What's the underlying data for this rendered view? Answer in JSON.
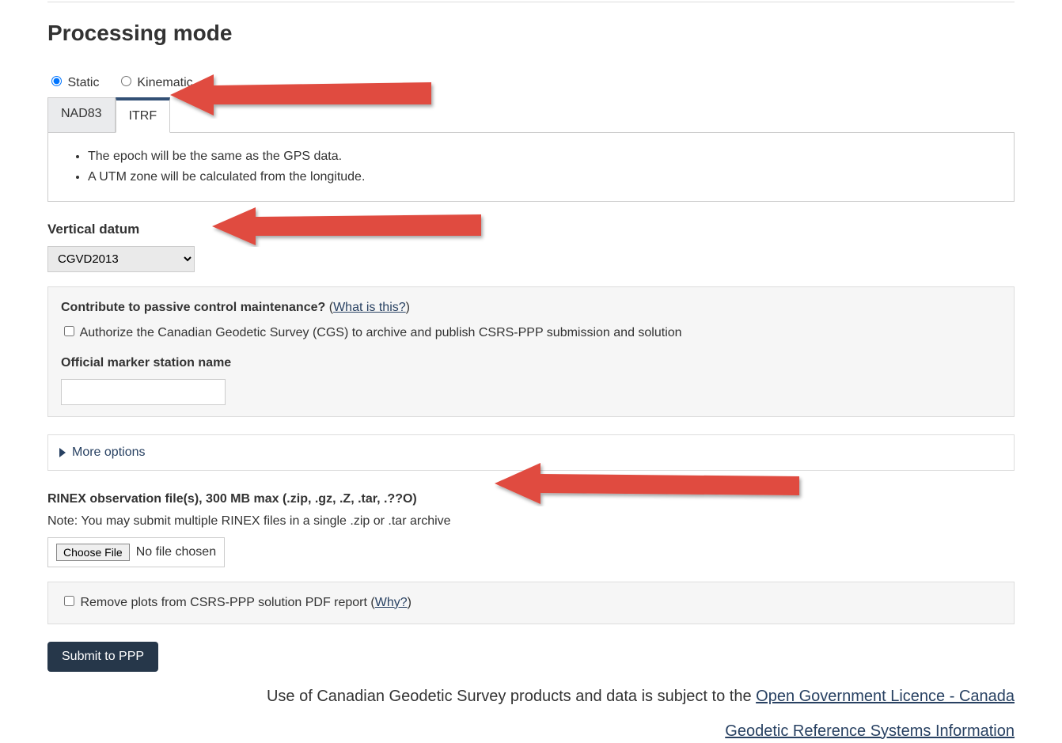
{
  "title": "Processing mode",
  "radios": {
    "static": "Static",
    "kinematic": "Kinematic",
    "selected": "static"
  },
  "tabs": {
    "nad83": "NAD83",
    "itrf": "ITRF",
    "active": "itrf",
    "bullets": [
      "The epoch will be the same as the GPS data.",
      "A UTM zone will be calculated from the longitude."
    ]
  },
  "vertical_datum": {
    "label": "Vertical datum",
    "selected": "CGVD2013"
  },
  "contribute_panel": {
    "question": "Contribute to passive control maintenance?",
    "what_is_this": "What is this?",
    "authorize": "Authorize the Canadian Geodetic Survey (CGS) to archive and publish CSRS-PPP submission and solution",
    "marker_label": "Official marker station name",
    "marker_value": ""
  },
  "more_options": "More options",
  "rinex": {
    "head": "RINEX observation file(s), 300 MB max (.zip, .gz, .Z, .tar, .??O)",
    "note": "Note: You may submit multiple RINEX files in a single .zip or .tar archive",
    "choose": "Choose File",
    "nofile": "No file chosen"
  },
  "remove_plots": {
    "label_before": "Remove plots from CSRS-PPP solution PDF report (",
    "why": "Why?",
    "label_after": ")"
  },
  "submit": "Submit to PPP",
  "footer": {
    "licence_pre": "Use of Canadian Geodetic Survey products and data is subject to the ",
    "licence_link": "Open Government Licence - Canada",
    "info_link": "Geodetic Reference Systems Information"
  }
}
